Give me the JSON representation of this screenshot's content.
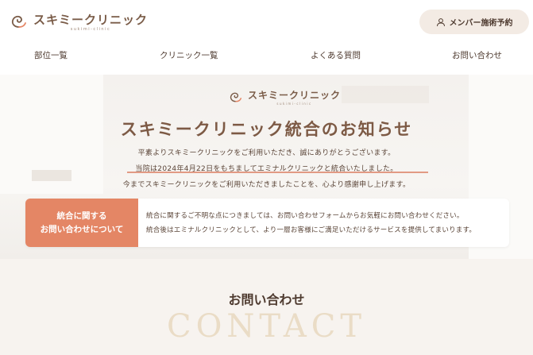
{
  "brand": {
    "name": "スキミークリニック",
    "sub": "sukimi-clinic",
    "logo_icon": "swirl-logo-icon"
  },
  "header": {
    "member_button": "メンバー施術予約",
    "member_icon": "user-icon"
  },
  "nav": {
    "items": [
      "部位一覧",
      "クリニック一覧",
      "よくある質問",
      "お問い合わせ"
    ]
  },
  "hero": {
    "title": "スキミークリニック統合のお知らせ",
    "line1": "平素よりスキミークリニックをご利用いただき、誠にありがとうございます。",
    "line2": "当院は2024年4月22日をもちましてエミナルクリニックと統合いたしました。",
    "line3": "今までスキミークリニックをご利用いただきましたことを、心より感謝申し上げます。"
  },
  "info": {
    "label_line1": "統合に関する",
    "label_line2": "お問い合わせについて",
    "text1": "統合に関するご不明な点につきましては、お問い合わせフォームからお気軽にお問い合わせください。",
    "text2": "統合後はエミナルクリニックとして、より一層お客様にご満足いただけるサービスを提供してまいります。"
  },
  "contact": {
    "title": "お問い合わせ",
    "big": "CONTACT"
  },
  "colors": {
    "accent": "#e48665",
    "underline": "#e29a84",
    "brand_brown": "#7d5a45",
    "contact_bg": "#f7f3ef",
    "button_bg": "#f3ebe4"
  }
}
